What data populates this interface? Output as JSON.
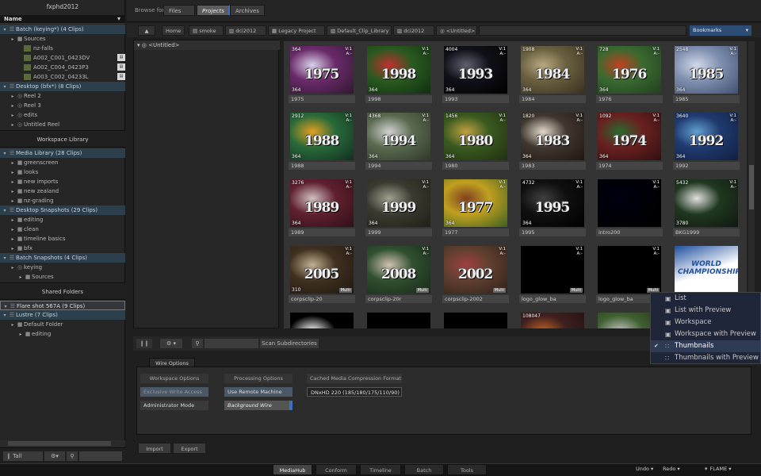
{
  "left_panel": {
    "title": "fxphd2012",
    "name_header": "Name",
    "rows": [
      {
        "label": "Batch (keying*) (4 Clips)",
        "kind": "section",
        "indent": 0
      },
      {
        "label": "Sources",
        "kind": "folder",
        "indent": 2
      },
      {
        "label": "nz-falls",
        "kind": "clip",
        "indent": 4
      },
      {
        "label": "A002_C001_0423DV",
        "kind": "clip",
        "indent": 4
      },
      {
        "label": "A002_C004_0423P3",
        "kind": "clip",
        "indent": 4
      },
      {
        "label": "A003_C002_04233L",
        "kind": "clip",
        "indent": 4
      },
      {
        "label": "Desktop (bfx*) (8 Clips)",
        "kind": "section",
        "indent": 0
      },
      {
        "label": "Reel 2",
        "kind": "reel",
        "indent": 2
      },
      {
        "label": "Reel 3",
        "kind": "reel",
        "indent": 2
      },
      {
        "label": "edits",
        "kind": "reel",
        "indent": 2
      },
      {
        "label": "Untitled Reel",
        "kind": "reel",
        "indent": 2
      }
    ],
    "workspace_library_header": "Workspace Library",
    "rows2": [
      {
        "label": "Media Library (28 Clips)",
        "kind": "section",
        "indent": 0
      },
      {
        "label": "greenscreen",
        "kind": "folder",
        "indent": 2
      },
      {
        "label": "looks",
        "kind": "folder",
        "indent": 2
      },
      {
        "label": "new imports",
        "kind": "folder",
        "indent": 2
      },
      {
        "label": "new zealand",
        "kind": "folder",
        "indent": 2
      },
      {
        "label": "nz-grading",
        "kind": "folder",
        "indent": 2
      },
      {
        "label": "Desktop Snapshots (29 Clips)",
        "kind": "section",
        "indent": 0
      },
      {
        "label": "editing",
        "kind": "folder",
        "indent": 2
      },
      {
        "label": "clean",
        "kind": "folder",
        "indent": 2
      },
      {
        "label": "timeline basics",
        "kind": "folder",
        "indent": 2
      },
      {
        "label": "bfx",
        "kind": "folder",
        "indent": 2
      },
      {
        "label": "Batch Snapshots (4 Clips)",
        "kind": "section",
        "indent": 0
      },
      {
        "label": "keying",
        "kind": "reel",
        "indent": 2
      },
      {
        "label": "Sources",
        "kind": "folder",
        "indent": 4
      }
    ],
    "shared_folders_header": "Shared Folders",
    "rows3": [
      {
        "label": "Flare shot 567A (9 Clips)",
        "kind": "section-alt",
        "indent": 0
      },
      {
        "label": "Lustre (7 Clips)",
        "kind": "section",
        "indent": 0
      },
      {
        "label": "Default Folder",
        "kind": "folder",
        "indent": 2
      },
      {
        "label": "editing",
        "kind": "folder",
        "indent": 4
      }
    ],
    "bottom": {
      "view_mode": "Tall"
    }
  },
  "topbar": {
    "browse_for_label": "Browse for:",
    "tabs": [
      "Files",
      "Projects",
      "Archives"
    ],
    "selected_tab": "Projects"
  },
  "pathbar": {
    "home": "Home",
    "segments": [
      "smoke",
      "dci2012",
      "Legacy Project",
      "Default_Clip_Library",
      "dci2012",
      "<Untitled>"
    ],
    "bookmarks": "Bookmarks"
  },
  "tree": {
    "root": "<Untitled>"
  },
  "thumbnails": [
    {
      "caption": "1975",
      "year": "1975",
      "frame_top": "364",
      "frame_bottom": "364",
      "colors": [
        "#6a2a6a",
        "#d8d0e8",
        "#301830"
      ]
    },
    {
      "caption": "1998",
      "year": "1998",
      "frame_top": "",
      "frame_bottom": "364",
      "colors": [
        "#2a5a20",
        "#c03030",
        "#103010"
      ]
    },
    {
      "caption": "1993",
      "year": "1993",
      "frame_top": "4004",
      "frame_bottom": "364",
      "colors": [
        "#101018",
        "#606070",
        "#000000"
      ]
    },
    {
      "caption": "1984",
      "year": "1984",
      "frame_top": "1908",
      "frame_bottom": "364",
      "colors": [
        "#6a6040",
        "#b8a880",
        "#3a3020"
      ]
    },
    {
      "caption": "1976",
      "year": "1976",
      "frame_top": "728",
      "frame_bottom": "364",
      "colors": [
        "#3a6a30",
        "#c04020",
        "#204020"
      ]
    },
    {
      "caption": "1985",
      "year": "1985",
      "frame_top": "2548",
      "frame_bottom": "364",
      "colors": [
        "#8090b0",
        "#d0d8e8",
        "#405070"
      ]
    },
    {
      "caption": "1988",
      "year": "1988",
      "frame_top": "2912",
      "frame_bottom": "364",
      "colors": [
        "#2a6a3a",
        "#e0a020",
        "#103020"
      ]
    },
    {
      "caption": "1994",
      "year": "1994",
      "frame_top": "4368",
      "frame_bottom": "364",
      "colors": [
        "#5a6a50",
        "#d0d0d0",
        "#303828"
      ]
    },
    {
      "caption": "1980",
      "year": "1980",
      "frame_top": "1456",
      "frame_bottom": "364",
      "colors": [
        "#3a5a20",
        "#c0a040",
        "#203010"
      ]
    },
    {
      "caption": "1983",
      "year": "1983",
      "frame_top": "1820",
      "frame_bottom": "364",
      "colors": [
        "#403830",
        "#e0d8c8",
        "#201810"
      ]
    },
    {
      "caption": "1974",
      "year": "1974",
      "frame_top": "1092",
      "frame_bottom": "364",
      "colors": [
        "#6a2020",
        "#2a6a30",
        "#301010"
      ]
    },
    {
      "caption": "1992",
      "year": "1992",
      "frame_top": "3640",
      "frame_bottom": "364",
      "colors": [
        "#203a70",
        "#60a0d0",
        "#102040"
      ]
    },
    {
      "caption": "1989",
      "year": "1989",
      "frame_top": "3276",
      "frame_bottom": "364",
      "colors": [
        "#602030",
        "#d0c0c0",
        "#301018"
      ]
    },
    {
      "caption": "1999",
      "year": "1999",
      "frame_top": "",
      "frame_bottom": "364",
      "colors": [
        "#3a3a30",
        "#a0a090",
        "#202018"
      ]
    },
    {
      "caption": "1977",
      "year": "1977",
      "frame_top": "",
      "frame_bottom": "364",
      "colors": [
        "#c0a020",
        "#804020",
        "#406020"
      ]
    },
    {
      "caption": "1995",
      "year": "1995",
      "frame_top": "4732",
      "frame_bottom": "364",
      "colors": [
        "#101010",
        "#404040",
        "#000000"
      ]
    },
    {
      "caption": "intro200",
      "year": "",
      "frame_top": "",
      "frame_bottom": "",
      "colors": [
        "#000008",
        "#000010",
        "#000000"
      ]
    },
    {
      "caption": "BKG1999",
      "year": "",
      "frame_top": "5432",
      "frame_bottom": "3780",
      "colors": [
        "#203820",
        "#e0e0e0",
        "#101810"
      ]
    },
    {
      "caption": "corpsclip-20",
      "year": "2005",
      "frame_top": "",
      "frame_bottom": "310",
      "colors": [
        "#403020",
        "#c0b090",
        "#201810"
      ]
    },
    {
      "caption": "corpsclip-20r",
      "year": "2008",
      "frame_top": "",
      "frame_bottom": "",
      "colors": [
        "#305030",
        "#d0c0b0",
        "#182818"
      ]
    },
    {
      "caption": "corpsclip-2002",
      "year": "2002",
      "frame_top": "",
      "frame_bottom": "",
      "colors": [
        "#604030",
        "#a04040",
        "#302018"
      ]
    },
    {
      "caption": "logo_glow_ba",
      "year": "",
      "frame_top": "",
      "frame_bottom": "",
      "colors": [
        "#000000",
        "#000000",
        "#000000"
      ],
      "multi": true
    },
    {
      "caption": "logo_glow_ba",
      "year": "",
      "frame_top": "",
      "frame_bottom": "",
      "colors": [
        "#000000",
        "#000000",
        "#000000"
      ],
      "multi": true
    },
    {
      "caption": "",
      "year": "",
      "frame_top": "",
      "frame_bottom": "",
      "colors": [
        "#2050a0",
        "#ffffff",
        "#c02020"
      ],
      "logo": "WORLD CHAMPIONSHIPS"
    },
    {
      "caption": "",
      "year": "",
      "frame_top": "",
      "frame_bottom": "",
      "colors": [
        "#000000",
        "#ffffff",
        "#000000"
      ]
    },
    {
      "caption": "",
      "year": "",
      "frame_top": "",
      "frame_bottom": "",
      "colors": [
        "#000000",
        "#000000",
        "#000000"
      ]
    },
    {
      "caption": "",
      "year": "",
      "frame_top": "",
      "frame_bottom": "",
      "colors": [
        "#000000",
        "#000000",
        "#000000"
      ]
    },
    {
      "caption": "",
      "year": "",
      "frame_top": "108047",
      "frame_bottom": "",
      "colors": [
        "#402020",
        "#c06020",
        "#201010"
      ]
    },
    {
      "caption": "",
      "year": "",
      "frame_top": "",
      "frame_bottom": "",
      "colors": [
        "#406030",
        "#c0c0c0",
        "#203018"
      ]
    }
  ],
  "grid_labels": {
    "va": "V:1\nA:-",
    "multi": "Multi"
  },
  "midbar": {
    "scan_subdirectories": "Scan Subdirectories"
  },
  "options": {
    "tab": "Wire Options",
    "workspace_options": "Workspace Options",
    "exclusive_write_access": "Exclusive Write Access",
    "administrator_mode": "Administrator Mode",
    "processing_options": "Processing Options",
    "use_remote_machine": "Use Remote Machine",
    "background_wire": "Background Wire",
    "cached_media_compression_format": "Cached Media Compression Format",
    "format_value": "DNxHD 220 (185/180/175/110/90)"
  },
  "bottom_buttons": {
    "import": "Import",
    "export": "Export"
  },
  "status_tabs": [
    "MediaHub",
    "Conform",
    "Timeline",
    "Batch",
    "Tools"
  ],
  "selected_status_tab": "MediaHub",
  "status_right": {
    "undo": "Undo",
    "redo": "Redo",
    "app": "FLAME"
  },
  "view_menu": {
    "items": [
      "List",
      "List with Preview",
      "Workspace",
      "Workspace with Preview",
      "Thumbnails",
      "Thumbnails with Preview"
    ],
    "selected": "Thumbnails"
  }
}
